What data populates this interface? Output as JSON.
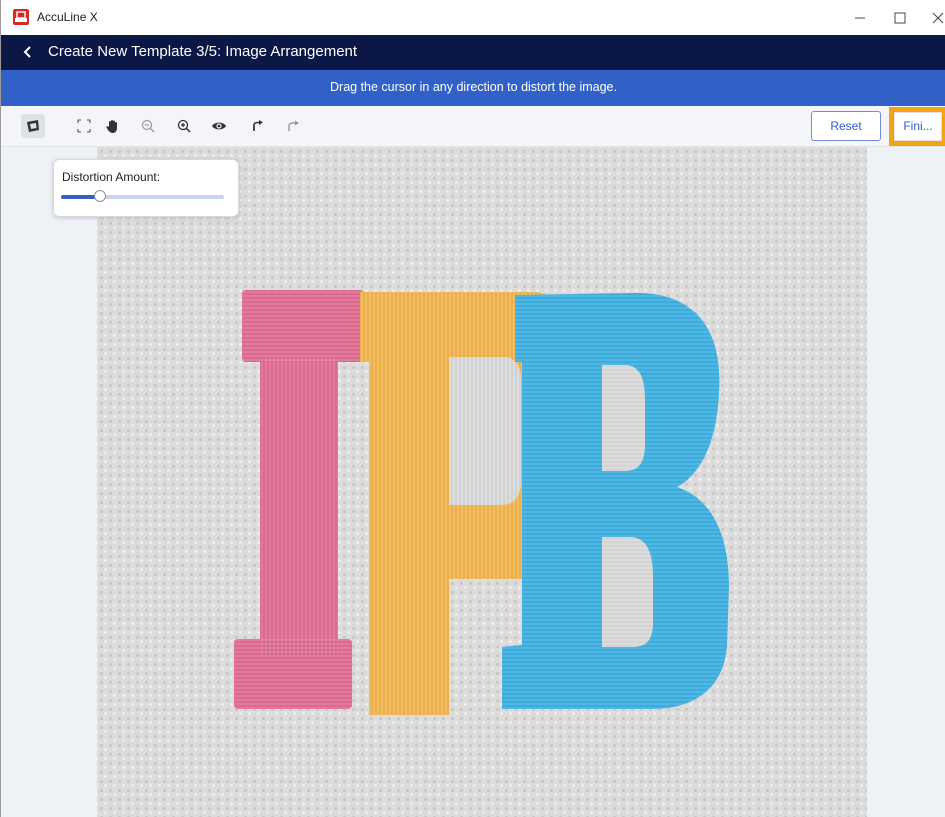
{
  "window": {
    "title": "AccuLine X",
    "controls": [
      "minimize-icon",
      "maximize-icon",
      "close-icon"
    ]
  },
  "header": {
    "title": "Create New Template 3/5: Image Arrangement",
    "back_icon": "chevron-left-icon"
  },
  "banner": {
    "text": "Drag the cursor in any direction to distort the image."
  },
  "toolbar": {
    "tools": [
      {
        "name": "distort-tool",
        "icon": "distort-icon",
        "active": true
      },
      {
        "name": "fit-to-screen",
        "icon": "fit-screen-icon"
      },
      {
        "name": "pan-tool",
        "icon": "hand-icon"
      },
      {
        "name": "zoom-out",
        "icon": "zoom-out-icon"
      },
      {
        "name": "zoom-in",
        "icon": "zoom-in-icon"
      },
      {
        "name": "preview",
        "icon": "eye-icon"
      },
      {
        "name": "undo",
        "icon": "undo-icon"
      },
      {
        "name": "redo",
        "icon": "redo-icon"
      }
    ],
    "reset_label": "Reset",
    "finish_label": "Fini..."
  },
  "distortion_panel": {
    "label": "Distortion Amount:",
    "value": 0.24
  },
  "image": {
    "content": "embroidered letters IPB",
    "colors": {
      "pink": "#e06d93",
      "orange": "#f0b64f",
      "blue": "#40b0e1"
    }
  },
  "colors": {
    "header_bg": "#0b1846",
    "banner_bg": "#3161c7",
    "accent": "#2f5cc8",
    "highlight": "#f2a412"
  }
}
